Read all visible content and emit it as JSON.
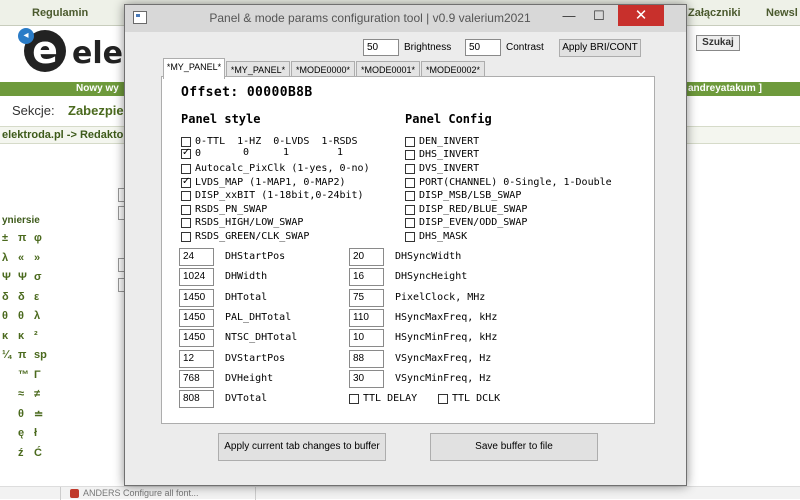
{
  "background": {
    "nav": [
      "Regulamin",
      "Załączniki",
      "Newsl"
    ],
    "logo_text": "elek",
    "search_button": "Szukaj",
    "green_bar_left": "Nowy wy",
    "green_bar_right": "andreyatakum ]",
    "sections_label": "Sekcje:",
    "sections_link": "Zabezpiec",
    "breadcrumb": "elektroda.pl -> Redakto",
    "sidebar_title": "yniersie",
    "symbol_rows": [
      [
        "±",
        "π",
        "φ"
      ],
      [
        "λ",
        "«",
        "»"
      ],
      [
        "Ψ",
        "Ψ",
        "σ"
      ],
      [
        "δ",
        "δ",
        "ε"
      ],
      [
        "θ",
        "θ",
        "λ"
      ],
      [
        "κ",
        "κ",
        "²"
      ],
      [
        "¼",
        "π",
        "sp"
      ],
      [
        "",
        "™",
        "Γ"
      ],
      [
        "",
        "≈",
        "≠"
      ],
      [
        "",
        "θ",
        "≐"
      ],
      [
        "",
        "ę",
        "ł"
      ],
      [
        "",
        "ź",
        "Ć"
      ]
    ],
    "bottom_tab": "ANDERS Configure all font..."
  },
  "window": {
    "title": "Panel & mode params configuration tool | v0.9 valerium2021",
    "minimize": "—",
    "maximize": "☐",
    "close": "✕"
  },
  "top": {
    "brightness_value": "50",
    "brightness_label": "Brightness",
    "contrast_value": "50",
    "contrast_label": "Contrast",
    "apply_label": "Apply BRI/CONT"
  },
  "tabs": [
    {
      "label": "*MY_PANEL*",
      "active": true
    },
    {
      "label": "*MY_PANEL*",
      "active": false
    },
    {
      "label": "*MODE0000*",
      "active": false
    },
    {
      "label": "*MODE0001*",
      "active": false
    },
    {
      "label": "*MODE0002*",
      "active": false
    }
  ],
  "offset": "Offset: 00000B8B",
  "panel_style": {
    "title": "Panel style",
    "items": [
      {
        "label": "0-TTL  1-HZ  0-LVDS  1-RSDS",
        "checked": false
      },
      {
        "label": "0",
        "checked": true
      },
      {
        "label": "Autocalc_PixClk (1-yes, 0-no)",
        "checked": false
      },
      {
        "label": "LVDS_MAP (1-MAP1, 0-MAP2)",
        "checked": true
      },
      {
        "label": "DISP_xxBIT (1-18bit,0-24bit)",
        "checked": false
      },
      {
        "label": "RSDS_PN_SWAP",
        "checked": false
      },
      {
        "label": "RSDS_HIGH/LOW_SWAP",
        "checked": false
      },
      {
        "label": "RSDS_GREEN/CLK_SWAP",
        "checked": false
      }
    ],
    "sub_values": [
      "0",
      "1",
      "1"
    ]
  },
  "panel_config": {
    "title": "Panel Config",
    "items": [
      {
        "label": "DEN_INVERT",
        "checked": false
      },
      {
        "label": "DHS_INVERT",
        "checked": false
      },
      {
        "label": "DVS_INVERT",
        "checked": false
      },
      {
        "label": "PORT(CHANNEL) 0-Single, 1-Double",
        "checked": false
      },
      {
        "label": "DISP_MSB/LSB_SWAP",
        "checked": false
      },
      {
        "label": "DISP_RED/BLUE_SWAP",
        "checked": false
      },
      {
        "label": "DISP_EVEN/ODD_SWAP",
        "checked": false
      },
      {
        "label": "DHS_MASK",
        "checked": false
      }
    ]
  },
  "params_left": [
    {
      "value": "24",
      "label": "DHStartPos"
    },
    {
      "value": "1024",
      "label": "DHWidth"
    },
    {
      "value": "1450",
      "label": "DHTotal"
    },
    {
      "value": "1450",
      "label": "PAL_DHTotal"
    },
    {
      "value": "1450",
      "label": "NTSC_DHTotal"
    },
    {
      "value": "12",
      "label": "DVStartPos"
    },
    {
      "value": "768",
      "label": "DVHeight"
    },
    {
      "value": "808",
      "label": "DVTotal"
    }
  ],
  "params_right": [
    {
      "value": "20",
      "label": "DHSyncWidth"
    },
    {
      "value": "16",
      "label": "DHSyncHeight"
    },
    {
      "value": "75",
      "label": "PixelClock, MHz"
    },
    {
      "value": "110",
      "label": "HSyncMaxFreq, kHz"
    },
    {
      "value": "10",
      "label": "HSyncMinFreq, kHz"
    },
    {
      "value": "88",
      "label": "VSyncMaxFreq, Hz"
    },
    {
      "value": "30",
      "label": "VSyncMinFreq, Hz"
    }
  ],
  "ttl_delay": {
    "label": "TTL DELAY",
    "checked": false
  },
  "ttl_dclk": {
    "label": "TTL DCLK",
    "checked": false
  },
  "buttons": {
    "apply_tab": "Apply current tab changes to buffer",
    "save": "Save buffer to file"
  },
  "colors": {
    "close_button": "#c8302c",
    "site_green": "#6e9a3c"
  }
}
